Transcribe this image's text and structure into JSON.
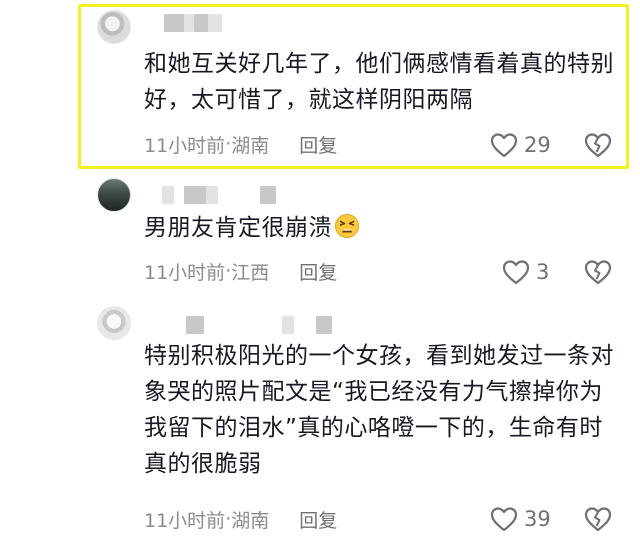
{
  "comments": [
    {
      "text": "和她互关好几年了，他们俩感情看着真的特别好，太可惜了，就这样阴阳两隔",
      "time": "11小时前",
      "location": "湖南",
      "reply_label": "回复",
      "likes": "29",
      "highlighted": true
    },
    {
      "text": "男朋友肯定很崩溃",
      "emoji": "tired-face-emoji",
      "time": "11小时前",
      "location": "江西",
      "reply_label": "回复",
      "likes": "3"
    },
    {
      "text": "特别积极阳光的一个女孩，看到她发过一条对象哭的照片配文是“我已经没有力气擦掉你为我留下的泪水”真的心咯噔一下的，生命有时真的很脆弱",
      "time": "11小时前",
      "location": "湖南",
      "reply_label": "回复",
      "likes": "39"
    }
  ],
  "meta_separator": " · ",
  "colors": {
    "highlight": "#f7f01f",
    "text": "#161823",
    "meta": "#8a8b91"
  },
  "icons": [
    "heart-outline-icon",
    "broken-heart-icon",
    "tired-face-emoji"
  ]
}
